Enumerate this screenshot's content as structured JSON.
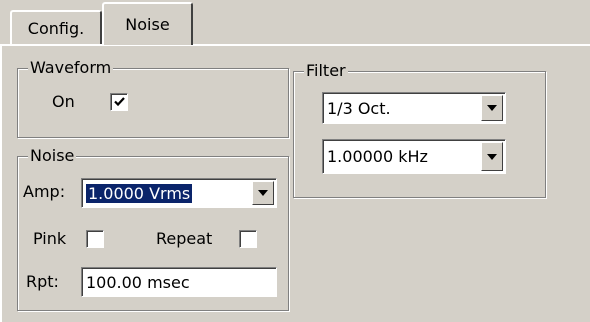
{
  "tabs": [
    {
      "label": "Config.",
      "active": false
    },
    {
      "label": "Noise",
      "active": true
    }
  ],
  "waveform": {
    "title": "Waveform",
    "on_label": "On",
    "on_checked": true
  },
  "noise": {
    "title": "Noise",
    "amp_label": "Amp:",
    "amp_value": "1.0000 Vrms",
    "pink_label": "Pink",
    "pink_checked": false,
    "repeat_label": "Repeat",
    "repeat_checked": false,
    "rpt_label": "Rpt:",
    "rpt_value": "100.00 msec"
  },
  "filter": {
    "title": "Filter",
    "type_value": "1/3 Oct.",
    "freq_value": "1.00000 kHz"
  },
  "icons": {
    "checkmark": "checkmark-icon",
    "dropdown": "chevron-down-icon"
  },
  "colors": {
    "background": "#d4d0c8",
    "selection": "#0a246a"
  }
}
